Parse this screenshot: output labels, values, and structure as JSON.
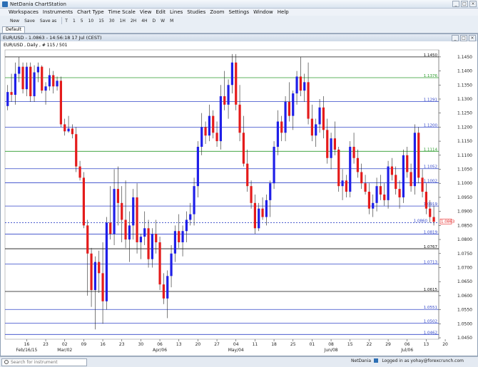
{
  "app": {
    "title": "NetDania ChartStation"
  },
  "menu": [
    "Workspaces",
    "Instruments",
    "Chart Type",
    "Time Scale",
    "View",
    "Edit",
    "Lines",
    "Studies",
    "Zoom",
    "Settings",
    "Window",
    "Help"
  ],
  "toolbar": {
    "labels": [
      "New",
      "Save",
      "Save as"
    ],
    "timescales": [
      "T",
      "1",
      "5",
      "10",
      "15",
      "30",
      "1H",
      "2H",
      "4H",
      "D",
      "W",
      "M"
    ]
  },
  "tab": {
    "label": "Default"
  },
  "chart": {
    "header": "EUR/USD - 1.0863 - 14:56:18 17 Jul (CEST)",
    "legend": "EUR/USD , Daily , # 115 / 501"
  },
  "statusbar": {
    "search_placeholder": "Search for instrument",
    "brand": "NetDania",
    "user": "Logged in as yohay@forexcrunch.com"
  },
  "colors": {
    "up": "#1f1fe8",
    "down": "#e41b1b",
    "hline_blue": "#3246c8",
    "hline_green": "#2a9a2a",
    "hline_black": "#111111"
  },
  "chart_data": {
    "type": "candlestick",
    "instrument": "EUR/USD",
    "ylim": [
      1.0445,
      1.1475
    ],
    "y_ticks": [
      1.045,
      1.05,
      1.055,
      1.06,
      1.065,
      1.07,
      1.075,
      1.08,
      1.085,
      1.09,
      1.095,
      1.1,
      1.105,
      1.11,
      1.115,
      1.12,
      1.125,
      1.13,
      1.135,
      1.14,
      1.145
    ],
    "y_tick_labels": [
      "1.0450",
      "1.0500",
      "1.0550",
      "1.0600",
      "1.0650",
      "1.0700",
      "1.0750",
      "1.0800",
      "1.0850",
      "1.0900",
      "1.0950",
      "1.1000",
      "1.1050",
      "1.1100",
      "1.1150",
      "1.1200",
      "1.1250",
      "1.1300",
      "1.1350",
      "1.1400",
      "1.1450"
    ],
    "x_ticks": [
      {
        "label": "16",
        "index": 5
      },
      {
        "label": "23",
        "index": 10
      },
      {
        "label": "02",
        "index": 15
      },
      {
        "label": "09",
        "index": 20
      },
      {
        "label": "16",
        "index": 25
      },
      {
        "label": "23",
        "index": 30
      },
      {
        "label": "30",
        "index": 35
      },
      {
        "label": "06",
        "index": 40
      },
      {
        "label": "13",
        "index": 45
      },
      {
        "label": "20",
        "index": 50
      },
      {
        "label": "27",
        "index": 55
      },
      {
        "label": "04",
        "index": 60
      },
      {
        "label": "11",
        "index": 65
      },
      {
        "label": "18",
        "index": 70
      },
      {
        "label": "25",
        "index": 75
      },
      {
        "label": "01",
        "index": 80
      },
      {
        "label": "08",
        "index": 85
      },
      {
        "label": "15",
        "index": 90
      },
      {
        "label": "22",
        "index": 95
      },
      {
        "label": "29",
        "index": 100
      },
      {
        "label": "06",
        "index": 105
      },
      {
        "label": "13",
        "index": 110
      },
      {
        "label": "20",
        "index": 115
      }
    ],
    "x_month_labels": [
      {
        "label": "Feb/16/15",
        "index": 5
      },
      {
        "label": "Mar/02",
        "index": 15
      },
      {
        "label": "Apr/06",
        "index": 40
      },
      {
        "label": "May/04",
        "index": 60
      },
      {
        "label": "Jun/08",
        "index": 85
      },
      {
        "label": "Jul/06",
        "index": 105
      }
    ],
    "h_lines": [
      {
        "value": 1.145,
        "label": "1.1450",
        "color": "#111111"
      },
      {
        "value": 1.1376,
        "label": "1.1376",
        "color": "#2a9a2a"
      },
      {
        "value": 1.1291,
        "label": "1.1291",
        "color": "#3246c8"
      },
      {
        "value": 1.12,
        "label": "1.1200",
        "color": "#3246c8"
      },
      {
        "value": 1.1114,
        "label": "1.1114",
        "color": "#2a9a2a"
      },
      {
        "value": 1.1052,
        "label": "1.1052",
        "color": "#3246c8"
      },
      {
        "value": 1.1002,
        "label": "1.1002",
        "color": "#3246c8"
      },
      {
        "value": 1.0919,
        "label": "1.0919",
        "color": "#3246c8"
      },
      {
        "value": 1.0819,
        "label": "1.0819",
        "color": "#3246c8"
      },
      {
        "value": 1.0767,
        "label": "1.0767",
        "color": "#111111"
      },
      {
        "value": 1.0713,
        "label": "1.0713",
        "color": "#3246c8"
      },
      {
        "value": 1.0615,
        "label": "1.0615",
        "color": "#111111"
      },
      {
        "value": 1.0551,
        "label": "1.0551",
        "color": "#3246c8"
      },
      {
        "value": 1.0502,
        "label": "1.0502",
        "color": "#3246c8"
      },
      {
        "value": 1.0462,
        "label": "1.0462",
        "color": "#3246c8"
      }
    ],
    "current": {
      "value": 1.0863,
      "label": "1.0863",
      "line_value": 1.086,
      "line_label": "1.0860"
    },
    "candles": [
      [
        1.1275,
        1.135,
        1.126,
        1.1325
      ],
      [
        1.1325,
        1.139,
        1.129,
        1.1315
      ],
      [
        1.1315,
        1.143,
        1.128,
        1.139
      ],
      [
        1.139,
        1.145,
        1.136,
        1.1415
      ],
      [
        1.1415,
        1.143,
        1.132,
        1.1335
      ],
      [
        1.1335,
        1.143,
        1.131,
        1.1415
      ],
      [
        1.1415,
        1.143,
        1.129,
        1.131
      ],
      [
        1.131,
        1.142,
        1.129,
        1.1395
      ],
      [
        1.1395,
        1.143,
        1.136,
        1.1415
      ],
      [
        1.1415,
        1.142,
        1.132,
        1.133
      ],
      [
        1.133,
        1.136,
        1.128,
        1.1345
      ],
      [
        1.1345,
        1.141,
        1.133,
        1.1385
      ],
      [
        1.1385,
        1.14,
        1.132,
        1.1345
      ],
      [
        1.1345,
        1.138,
        1.133,
        1.1365
      ],
      [
        1.1365,
        1.138,
        1.12,
        1.121
      ],
      [
        1.121,
        1.123,
        1.117,
        1.1185
      ],
      [
        1.1185,
        1.124,
        1.118,
        1.1195
      ],
      [
        1.1195,
        1.121,
        1.116,
        1.1175
      ],
      [
        1.1175,
        1.12,
        1.104,
        1.106
      ],
      [
        1.106,
        1.108,
        1.101,
        1.102
      ],
      [
        1.102,
        1.104,
        1.084,
        1.085
      ],
      [
        1.085,
        1.087,
        1.06,
        1.075
      ],
      [
        1.075,
        1.077,
        1.056,
        1.062
      ],
      [
        1.062,
        1.074,
        1.048,
        1.072
      ],
      [
        1.072,
        1.076,
        1.061,
        1.068
      ],
      [
        1.068,
        1.079,
        1.05,
        1.058
      ],
      [
        1.058,
        1.088,
        1.055,
        1.086
      ],
      [
        1.086,
        1.099,
        1.08,
        1.082
      ],
      [
        1.082,
        1.105,
        1.078,
        1.098
      ],
      [
        1.098,
        1.106,
        1.085,
        1.093
      ],
      [
        1.093,
        1.099,
        1.079,
        1.087
      ],
      [
        1.087,
        1.101,
        1.077,
        1.08
      ],
      [
        1.08,
        1.09,
        1.072,
        1.085
      ],
      [
        1.085,
        1.098,
        1.08,
        1.095
      ],
      [
        1.095,
        1.1,
        1.075,
        1.079
      ],
      [
        1.079,
        1.082,
        1.073,
        1.081
      ],
      [
        1.081,
        1.09,
        1.078,
        1.084
      ],
      [
        1.084,
        1.087,
        1.07,
        1.073
      ],
      [
        1.073,
        1.084,
        1.07,
        1.082
      ],
      [
        1.082,
        1.087,
        1.075,
        1.079
      ],
      [
        1.079,
        1.081,
        1.062,
        1.064
      ],
      [
        1.064,
        1.068,
        1.057,
        1.059
      ],
      [
        1.059,
        1.069,
        1.052,
        1.067
      ],
      [
        1.067,
        1.078,
        1.063,
        1.075
      ],
      [
        1.075,
        1.085,
        1.072,
        1.083
      ],
      [
        1.083,
        1.089,
        1.077,
        1.079
      ],
      [
        1.079,
        1.085,
        1.074,
        1.083
      ],
      [
        1.083,
        1.09,
        1.079,
        1.087
      ],
      [
        1.087,
        1.093,
        1.085,
        1.089
      ],
      [
        1.089,
        1.102,
        1.085,
        1.099
      ],
      [
        1.099,
        1.115,
        1.095,
        1.113
      ],
      [
        1.113,
        1.125,
        1.11,
        1.12
      ],
      [
        1.12,
        1.122,
        1.114,
        1.117
      ],
      [
        1.117,
        1.128,
        1.115,
        1.124
      ],
      [
        1.124,
        1.126,
        1.116,
        1.118
      ],
      [
        1.118,
        1.122,
        1.113,
        1.115
      ],
      [
        1.115,
        1.135,
        1.112,
        1.131
      ],
      [
        1.131,
        1.14,
        1.126,
        1.128
      ],
      [
        1.128,
        1.137,
        1.123,
        1.135
      ],
      [
        1.135,
        1.146,
        1.132,
        1.143
      ],
      [
        1.143,
        1.146,
        1.126,
        1.128
      ],
      [
        1.128,
        1.135,
        1.115,
        1.118
      ],
      [
        1.118,
        1.124,
        1.106,
        1.107
      ],
      [
        1.107,
        1.112,
        1.097,
        1.099
      ],
      [
        1.099,
        1.101,
        1.091,
        1.093
      ],
      [
        1.093,
        1.096,
        1.082,
        1.084
      ],
      [
        1.084,
        1.093,
        1.083,
        1.091
      ],
      [
        1.091,
        1.095,
        1.087,
        1.088
      ],
      [
        1.088,
        1.096,
        1.085,
        1.094
      ],
      [
        1.094,
        1.101,
        1.088,
        1.1
      ],
      [
        1.1,
        1.115,
        1.098,
        1.113
      ],
      [
        1.113,
        1.126,
        1.11,
        1.122
      ],
      [
        1.122,
        1.124,
        1.115,
        1.118
      ],
      [
        1.118,
        1.131,
        1.115,
        1.129
      ],
      [
        1.129,
        1.136,
        1.122,
        1.124
      ],
      [
        1.124,
        1.133,
        1.119,
        1.132
      ],
      [
        1.132,
        1.14,
        1.128,
        1.138
      ],
      [
        1.138,
        1.145,
        1.131,
        1.133
      ],
      [
        1.133,
        1.139,
        1.129,
        1.136
      ],
      [
        1.136,
        1.143,
        1.121,
        1.123
      ],
      [
        1.123,
        1.128,
        1.115,
        1.117
      ],
      [
        1.117,
        1.123,
        1.113,
        1.121
      ],
      [
        1.121,
        1.13,
        1.118,
        1.127
      ],
      [
        1.127,
        1.131,
        1.116,
        1.119
      ],
      [
        1.119,
        1.123,
        1.107,
        1.109
      ],
      [
        1.109,
        1.118,
        1.105,
        1.116
      ],
      [
        1.116,
        1.122,
        1.11,
        1.112
      ],
      [
        1.112,
        1.113,
        1.097,
        1.099
      ],
      [
        1.099,
        1.105,
        1.094,
        1.101
      ],
      [
        1.101,
        1.103,
        1.095,
        1.097
      ],
      [
        1.097,
        1.115,
        1.095,
        1.113
      ],
      [
        1.113,
        1.118,
        1.107,
        1.109
      ],
      [
        1.109,
        1.112,
        1.102,
        1.104
      ],
      [
        1.104,
        1.107,
        1.098,
        1.1
      ],
      [
        1.1,
        1.103,
        1.096,
        1.097
      ],
      [
        1.097,
        1.1,
        1.089,
        1.091
      ],
      [
        1.091,
        1.096,
        1.088,
        1.093
      ],
      [
        1.093,
        1.102,
        1.09,
        1.099
      ],
      [
        1.099,
        1.103,
        1.094,
        1.096
      ],
      [
        1.096,
        1.1,
        1.092,
        1.094
      ],
      [
        1.094,
        1.108,
        1.091,
        1.106
      ],
      [
        1.106,
        1.109,
        1.101,
        1.103
      ],
      [
        1.103,
        1.106,
        1.096,
        1.098
      ],
      [
        1.098,
        1.101,
        1.091,
        1.095
      ],
      [
        1.095,
        1.112,
        1.093,
        1.11
      ],
      [
        1.11,
        1.113,
        1.102,
        1.104
      ],
      [
        1.104,
        1.107,
        1.097,
        1.099
      ],
      [
        1.099,
        1.121,
        1.096,
        1.118
      ],
      [
        1.118,
        1.12,
        1.1,
        1.102
      ],
      [
        1.102,
        1.105,
        1.095,
        1.097
      ],
      [
        1.097,
        1.1,
        1.089,
        1.091
      ],
      [
        1.091,
        1.094,
        1.086,
        1.088
      ],
      [
        1.088,
        1.092,
        1.085,
        1.0863
      ]
    ]
  }
}
